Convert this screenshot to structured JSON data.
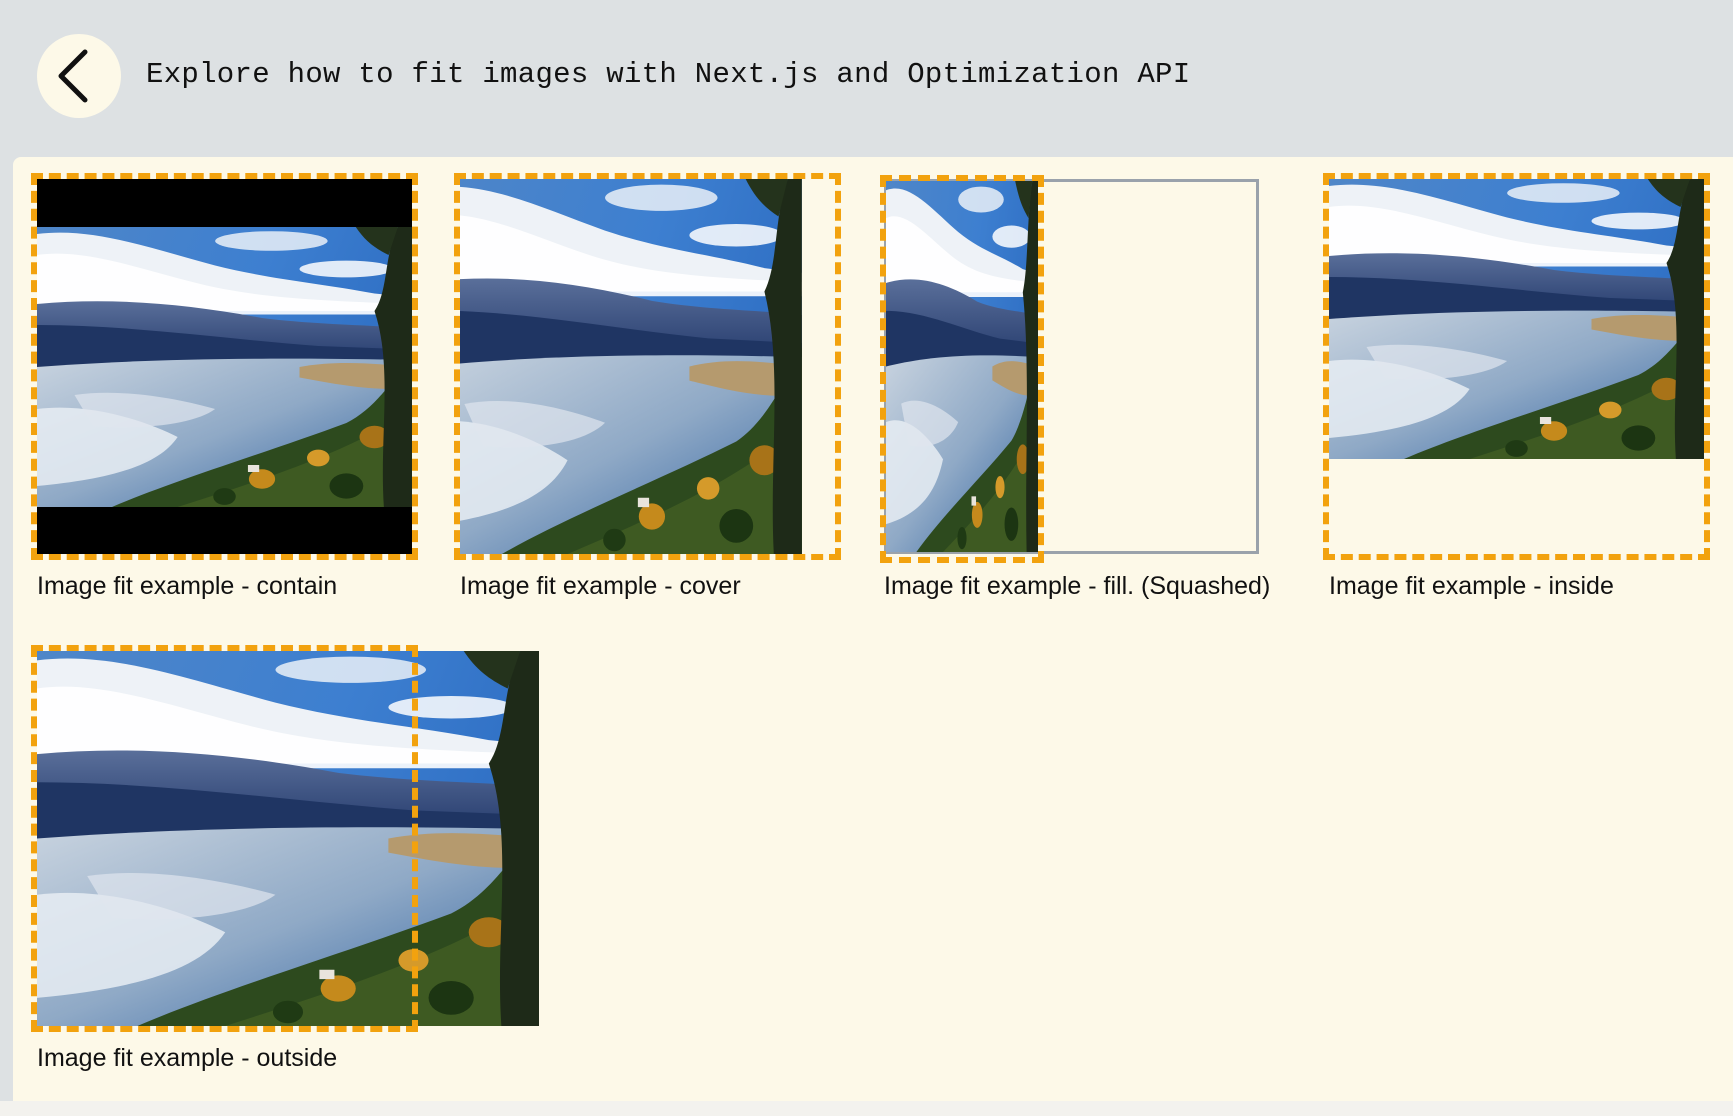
{
  "header": {
    "back_icon": "chevron-left-icon",
    "title": "Explore how to fit images with Next.js and Optimization API"
  },
  "examples": [
    {
      "fit": "contain",
      "caption": "Image fit example - contain"
    },
    {
      "fit": "cover",
      "caption": "Image fit example - cover"
    },
    {
      "fit": "fill",
      "caption": "Image fit example - fill. (Squashed)"
    },
    {
      "fit": "inside",
      "caption": "Image fit example - inside"
    },
    {
      "fit": "outside",
      "caption": "Image fit example - outside"
    }
  ],
  "colors": {
    "dashed_border": "#f2a20e",
    "panel_background": "#fdf9e8",
    "header_background": "#dde1e3"
  }
}
